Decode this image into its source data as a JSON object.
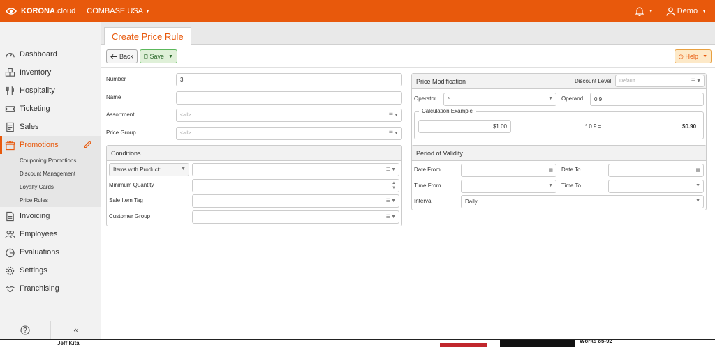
{
  "topbar": {
    "logo_bold": "KORONA",
    "logo_light": ".cloud",
    "company": "COMBASE USA",
    "user": "Demo"
  },
  "sidebar": {
    "items": [
      {
        "label": "Dashboard",
        "icon": "dashboard-icon"
      },
      {
        "label": "Inventory",
        "icon": "boxes-icon"
      },
      {
        "label": "Hospitality",
        "icon": "cutlery-icon"
      },
      {
        "label": "Ticketing",
        "icon": "ticket-icon"
      },
      {
        "label": "Sales",
        "icon": "receipt-icon"
      },
      {
        "label": "Promotions",
        "icon": "gift-icon",
        "active": true
      },
      {
        "label": "Invoicing",
        "icon": "invoice-icon"
      },
      {
        "label": "Employees",
        "icon": "people-icon"
      },
      {
        "label": "Evaluations",
        "icon": "pie-chart-icon"
      },
      {
        "label": "Settings",
        "icon": "gear-icon"
      },
      {
        "label": "Franchising",
        "icon": "handshake-icon"
      }
    ],
    "subitems": [
      "Couponing Promotions",
      "Discount Management",
      "Loyalty Cards",
      "Price Rules"
    ]
  },
  "tab": {
    "title": "Create Price Rule"
  },
  "toolbar": {
    "back_label": "Back",
    "save_label": "Save",
    "help_label": "Help"
  },
  "form": {
    "number_label": "Number",
    "number_value": "3",
    "name_label": "Name",
    "name_value": "",
    "assortment_label": "Assortment",
    "assortment_placeholder": "<all>",
    "price_group_label": "Price Group",
    "price_group_placeholder": "<all>"
  },
  "conditions": {
    "title": "Conditions",
    "type_select": "Items with Product:",
    "min_qty_label": "Minimum Quantity",
    "sale_tag_label": "Sale Item Tag",
    "customer_group_label": "Customer Group"
  },
  "price_mod": {
    "title": "Price Modification",
    "discount_level_label": "Discount Level",
    "discount_level_placeholder": "Default",
    "operator_label": "Operator",
    "operator_value": "*",
    "operand_label": "Operand",
    "operand_value": "0.9",
    "calc_legend": "Calculation Example",
    "calc_input": "$1.00",
    "calc_expr": "* 0.9 =",
    "calc_result": "$0.90"
  },
  "validity": {
    "title": "Period of Validity",
    "date_from_label": "Date From",
    "date_to_label": "Date To",
    "time_from_label": "Time From",
    "time_to_label": "Time To",
    "interval_label": "Interval",
    "interval_value": "Daily"
  },
  "bottom": {
    "text1": "Jeff Kita",
    "text2": "Works 85-92"
  }
}
